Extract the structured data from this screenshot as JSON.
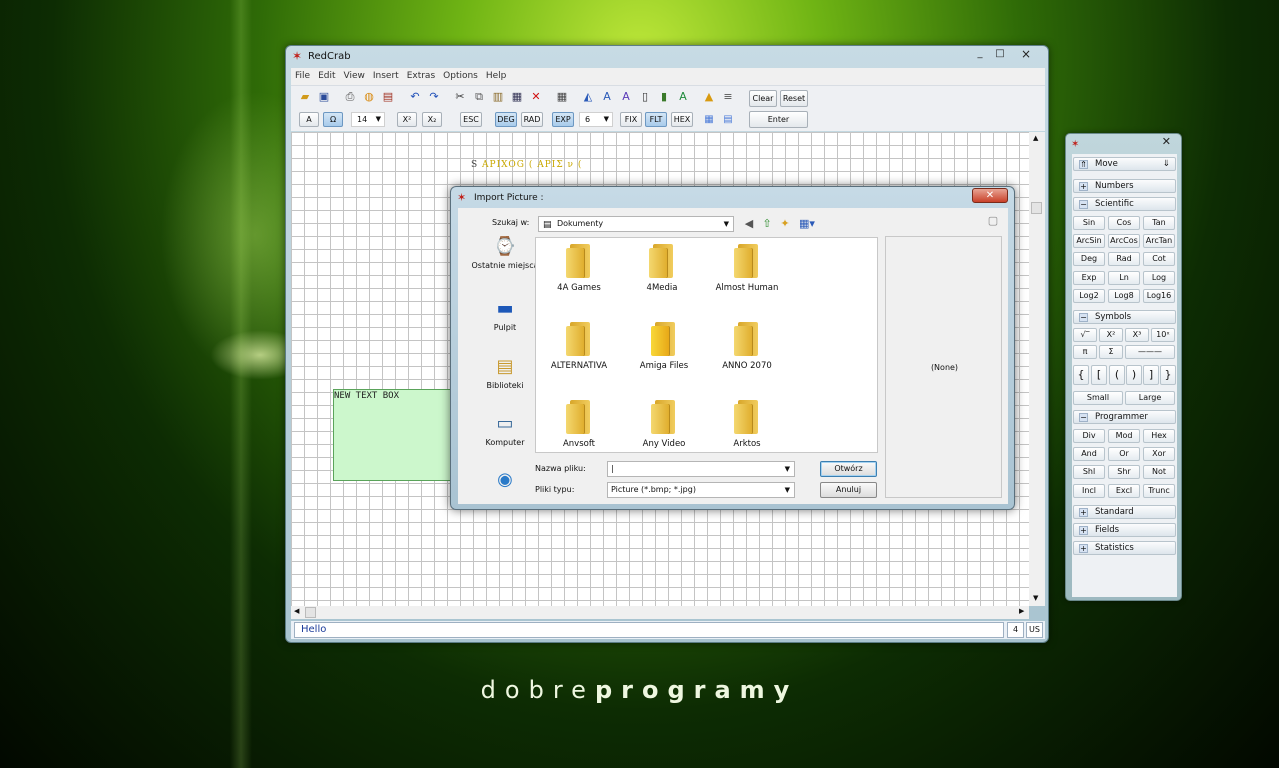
{
  "brand": {
    "part1": "dobre",
    "part2": "programy"
  },
  "app": {
    "title": "RedCrab",
    "win_min": "_",
    "win_max": "□",
    "win_close": "×"
  },
  "menu": [
    "File",
    "Edit",
    "View",
    "Insert",
    "Extras",
    "Options",
    "Help"
  ],
  "toolbar": {
    "btn_clear": "Clear",
    "btn_reset": "Reset",
    "btn_a": "A",
    "btn_omega": "Ω",
    "font_size": "14",
    "btn_sup": "X²",
    "btn_sub": "X₂",
    "btn_esc": "ESC",
    "btn_deg": "DEG",
    "btn_rad": "RAD",
    "btn_exp": "EXP",
    "precision": "6",
    "btn_fix": "FIX",
    "btn_flt": "FLT",
    "btn_hex": "HEX",
    "btn_enter": "Enter"
  },
  "worksheet": {
    "formula_lead": "S",
    "formula_body": "APIXOG ( APIΣ ν (",
    "textbox": "NEW TEXT BOX"
  },
  "status": {
    "text": "Hello",
    "num": "4",
    "lang": "US"
  },
  "dialog": {
    "title": "Import Picture :",
    "look_in_label": "Szukaj w:",
    "look_in_value": "Dokumenty",
    "places": [
      "Ostatnie miejsca",
      "Pulpit",
      "Biblioteki",
      "Komputer",
      ""
    ],
    "files": [
      "4A Games",
      "4Media",
      "Almost Human",
      "ALTERNATIVA",
      "Amiga Files",
      "ANNO 2070",
      "Anvsoft",
      "Any Video",
      "Arktos"
    ],
    "filename_label": "Nazwa pliku:",
    "filename_value": "|",
    "filetype_label": "Pliki typu:",
    "filetype_value": "Picture (*.bmp; *.jpg)",
    "open_button": "Otwórz",
    "cancel_button": "Anuluj",
    "preview": "(None)"
  },
  "palette": {
    "move": "Move",
    "numbers": "Numbers",
    "scientific": "Scientific",
    "sci_buttons": [
      "Sin",
      "Cos",
      "Tan",
      "ArcSin",
      "ArcCos",
      "ArcTan",
      "Deg",
      "Rad",
      "Cot",
      "Exp",
      "Ln",
      "Log",
      "Log2",
      "Log8",
      "Log16"
    ],
    "symbols": "Symbols",
    "sym_row1": [
      "√‾",
      "X²",
      "X³",
      "10ˣ"
    ],
    "sym_row2": [
      "π",
      "Σ",
      "———"
    ],
    "sym_row3": [
      "{",
      "[",
      "(",
      ")",
      "]",
      "}"
    ],
    "small": "Small",
    "large": "Large",
    "programmer": "Programmer",
    "prog_buttons": [
      "Div",
      "Mod",
      "Hex",
      "And",
      "Or",
      "Xor",
      "Shl",
      "Shr",
      "Not",
      "Incl",
      "Excl",
      "Trunc"
    ],
    "standard": "Standard",
    "fields": "Fields",
    "statistics": "Statistics"
  }
}
